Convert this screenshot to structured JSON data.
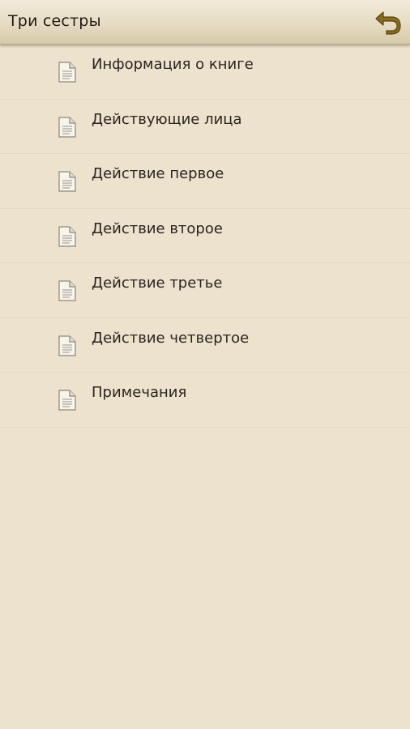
{
  "header": {
    "title": "Три сестры",
    "back_icon": "back-arrow-icon",
    "accent_color": "#8a6a1f"
  },
  "toc": {
    "items": [
      {
        "label": "Информация о книге",
        "icon": "document-icon"
      },
      {
        "label": "Действующие лица",
        "icon": "document-icon"
      },
      {
        "label": "Действие первое",
        "icon": "document-icon"
      },
      {
        "label": "Действие второе",
        "icon": "document-icon"
      },
      {
        "label": "Действие третье",
        "icon": "document-icon"
      },
      {
        "label": "Действие четвертое",
        "icon": "document-icon"
      },
      {
        "label": "Примечания",
        "icon": "document-icon"
      }
    ]
  },
  "colors": {
    "background": "#ede2cd",
    "header_gradient_top": "#f1ead8",
    "header_gradient_bottom": "#d7c9aa"
  }
}
